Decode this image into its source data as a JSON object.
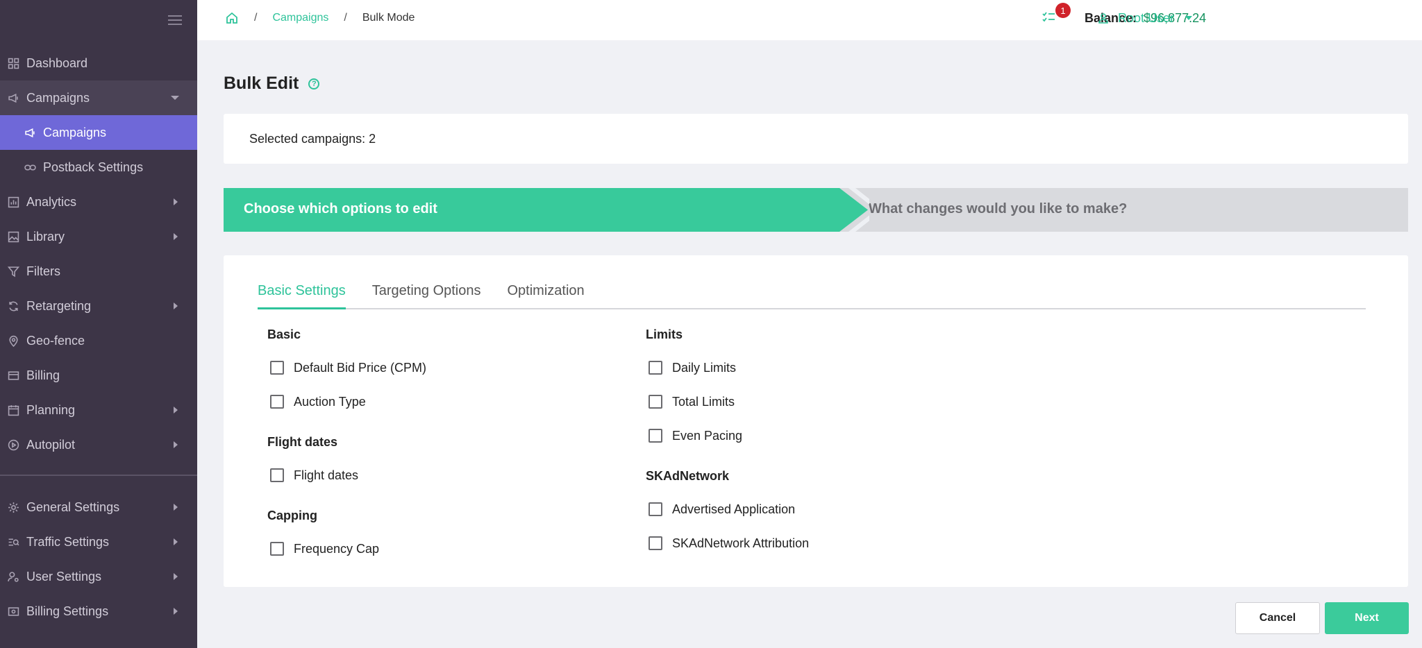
{
  "sidebar": {
    "items": [
      {
        "label": "Dashboard",
        "icon": "dashboard-icon"
      },
      {
        "label": "Campaigns",
        "icon": "megaphone-icon"
      },
      {
        "label": "Campaigns",
        "icon": "megaphone-icon"
      },
      {
        "label": "Postback Settings",
        "icon": "link-icon"
      },
      {
        "label": "Analytics",
        "icon": "bar-chart-icon"
      },
      {
        "label": "Library",
        "icon": "image-icon"
      },
      {
        "label": "Filters",
        "icon": "filter-icon"
      },
      {
        "label": "Retargeting",
        "icon": "refresh-icon"
      },
      {
        "label": "Geo-fence",
        "icon": "map-pin-icon"
      },
      {
        "label": "Billing",
        "icon": "credit-card-icon"
      },
      {
        "label": "Planning",
        "icon": "calendar-icon"
      },
      {
        "label": "Autopilot",
        "icon": "play-circle-icon"
      },
      {
        "label": "General Settings",
        "icon": "gear-icon"
      },
      {
        "label": "Traffic Settings",
        "icon": "traffic-icon"
      },
      {
        "label": "User Settings",
        "icon": "user-cog-icon"
      },
      {
        "label": "Billing Settings",
        "icon": "billing-icon"
      }
    ]
  },
  "header": {
    "breadcrumb": {
      "campaigns": "Campaigns",
      "current": "Bulk Mode"
    },
    "balance_label": "Balance:",
    "balance_value": "$96,877.24",
    "task_badge": "1",
    "user_name": "Root User"
  },
  "main": {
    "title": "Bulk Edit",
    "help_glyph": "?",
    "selected_text": "Selected campaigns: 2",
    "steps": {
      "step1": "Choose which options to edit",
      "step2": "What changes would you like to make?"
    },
    "tabs": [
      "Basic Settings",
      "Targeting Options",
      "Optimization"
    ],
    "left_groups": [
      {
        "title": "Basic",
        "options": [
          "Default Bid Price (CPM)",
          "Auction Type"
        ]
      },
      {
        "title": "Flight dates",
        "options": [
          "Flight dates"
        ]
      },
      {
        "title": "Capping",
        "options": [
          "Frequency Cap"
        ]
      }
    ],
    "right_groups": [
      {
        "title": "Limits",
        "options": [
          "Daily Limits",
          "Total Limits",
          "Even Pacing"
        ]
      },
      {
        "title": "SKAdNetwork",
        "options": [
          "Advertised Application",
          "SKAdNetwork Attribution"
        ]
      }
    ],
    "buttons": {
      "cancel": "Cancel",
      "next": "Next"
    }
  },
  "colors": {
    "accent": "#2ec39a",
    "sidebar_bg": "#3d3547",
    "sidebar_active": "#6f68d8",
    "badge": "#d0222a"
  }
}
